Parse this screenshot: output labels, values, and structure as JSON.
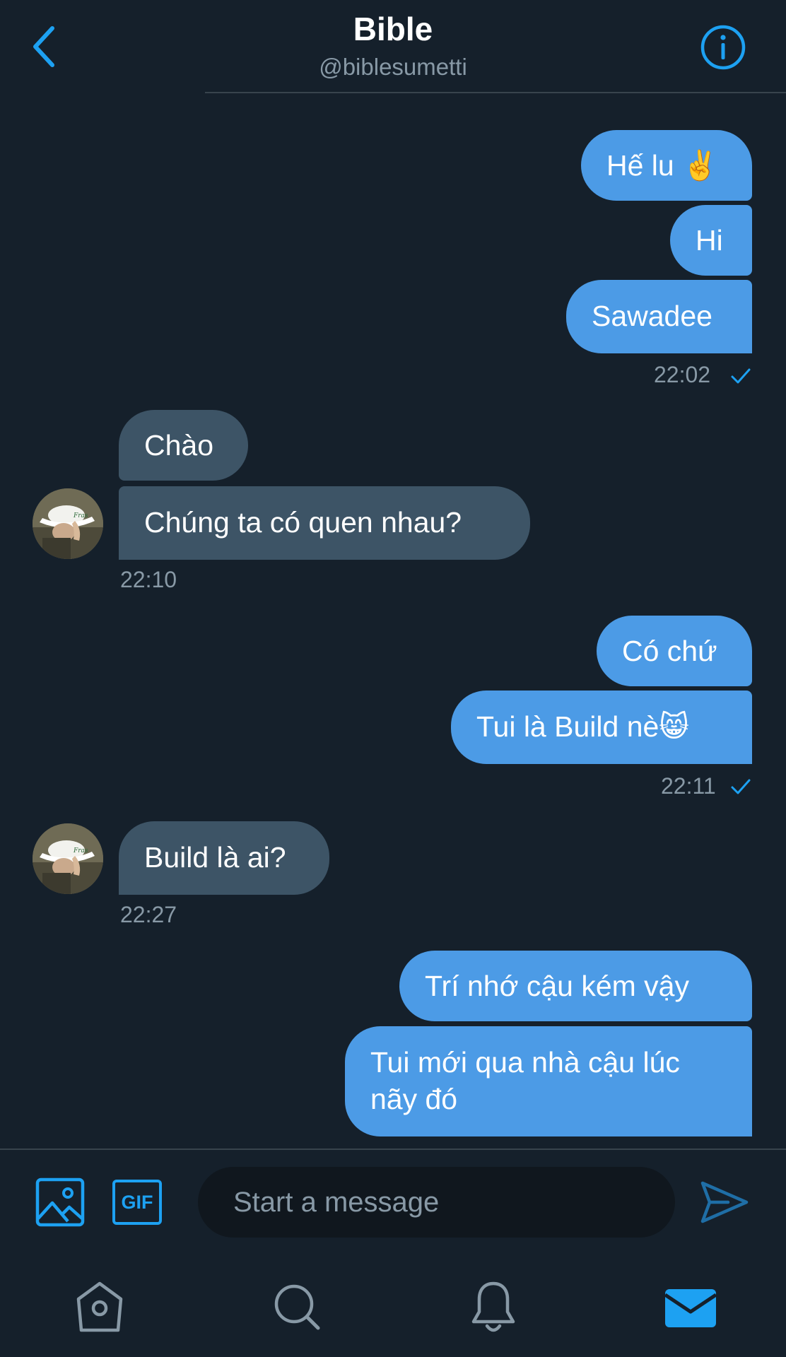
{
  "header": {
    "title": "Bible",
    "handle": "@biblesumetti"
  },
  "messages": {
    "m1": "Hế lu ✌️",
    "m2": "Hi",
    "m3": "Sawadee",
    "t1": "22:02",
    "m4": "Chào",
    "m5": "Chúng ta có quen nhau?",
    "t2": "22:10",
    "m6": "Có chứ",
    "m7": "Tui là Build nè😸",
    "t3": "22:11",
    "m8": "Build là ai?",
    "t4": "22:27",
    "m9": "Trí nhớ cậu kém vậy",
    "m10_line1": "Tui mới qua nhà cậu lúc",
    "m10_line2": "nãy đó"
  },
  "composer": {
    "placeholder": "Start a message",
    "gif_label": "GIF"
  },
  "icons": {
    "back": "chevron-left-icon",
    "info": "info-icon",
    "image": "image-icon",
    "gif": "gif-icon",
    "send": "send-icon",
    "home": "home-icon",
    "search": "search-icon",
    "notifications": "bell-icon",
    "messages": "envelope-icon",
    "read_receipt": "check-icon"
  },
  "colors": {
    "background": "#15202b",
    "accent": "#1da1f2",
    "outgoing_bubble": "#4c9be6",
    "incoming_bubble": "#3d5466",
    "muted_text": "#8899a6"
  }
}
